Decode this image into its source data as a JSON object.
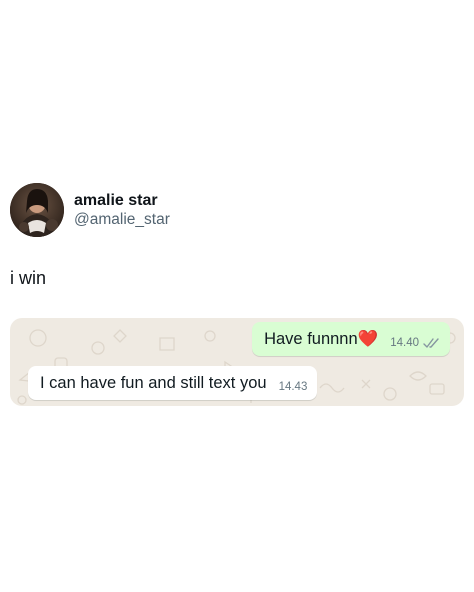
{
  "author": {
    "display_name": "amalie star",
    "handle": "@amalie_star"
  },
  "tweet": {
    "text": "i win"
  },
  "chat": {
    "messages": [
      {
        "direction": "outgoing",
        "text": "Have funnnn❤️",
        "time": "14.40",
        "status": "read"
      },
      {
        "direction": "incoming",
        "text": "I can have fun and still text you",
        "time": "14.43"
      }
    ],
    "colors": {
      "background": "#efeae2",
      "outgoing_bubble": "#d9fdd3",
      "incoming_bubble": "#ffffff",
      "read_ticks": "#8696a0"
    },
    "icons": {
      "read_receipt": "double-check-icon"
    }
  }
}
